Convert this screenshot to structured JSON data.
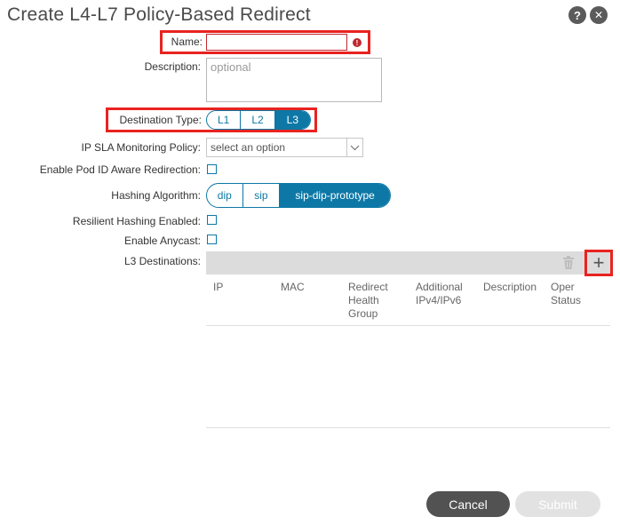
{
  "dialog": {
    "title": "Create L4-L7 Policy-Based Redirect",
    "help_label": "?",
    "close_label": "✕"
  },
  "form": {
    "name_label": "Name:",
    "name_value": "",
    "description_label": "Description:",
    "description_placeholder": "optional",
    "destination_type_label": "Destination Type:",
    "destination_type_options": [
      "L1",
      "L2",
      "L3"
    ],
    "destination_type_selected": "L3",
    "ip_sla_label": "IP SLA Monitoring Policy:",
    "ip_sla_placeholder": "select an option",
    "pod_id_label": "Enable Pod ID Aware Redirection:",
    "hashing_label": "Hashing Algorithm:",
    "hashing_options": [
      "dip",
      "sip",
      "sip-dip-prototype"
    ],
    "hashing_selected": "sip-dip-prototype",
    "resilient_label": "Resilient Hashing Enabled:",
    "anycast_label": "Enable Anycast:",
    "l3_destinations_label": "L3 Destinations:"
  },
  "table": {
    "columns": [
      [
        "IP"
      ],
      [
        "MAC"
      ],
      [
        "Redirect",
        "Health",
        "Group"
      ],
      [
        "Additional",
        "IPv4/IPv6"
      ],
      [
        "Description"
      ],
      [
        "Oper",
        "Status"
      ]
    ],
    "add_label": "+"
  },
  "footer": {
    "cancel_label": "Cancel",
    "submit_label": "Submit"
  },
  "colors": {
    "accent": "#0d78a6",
    "highlight": "#e8231f",
    "error": "#c0272d"
  }
}
